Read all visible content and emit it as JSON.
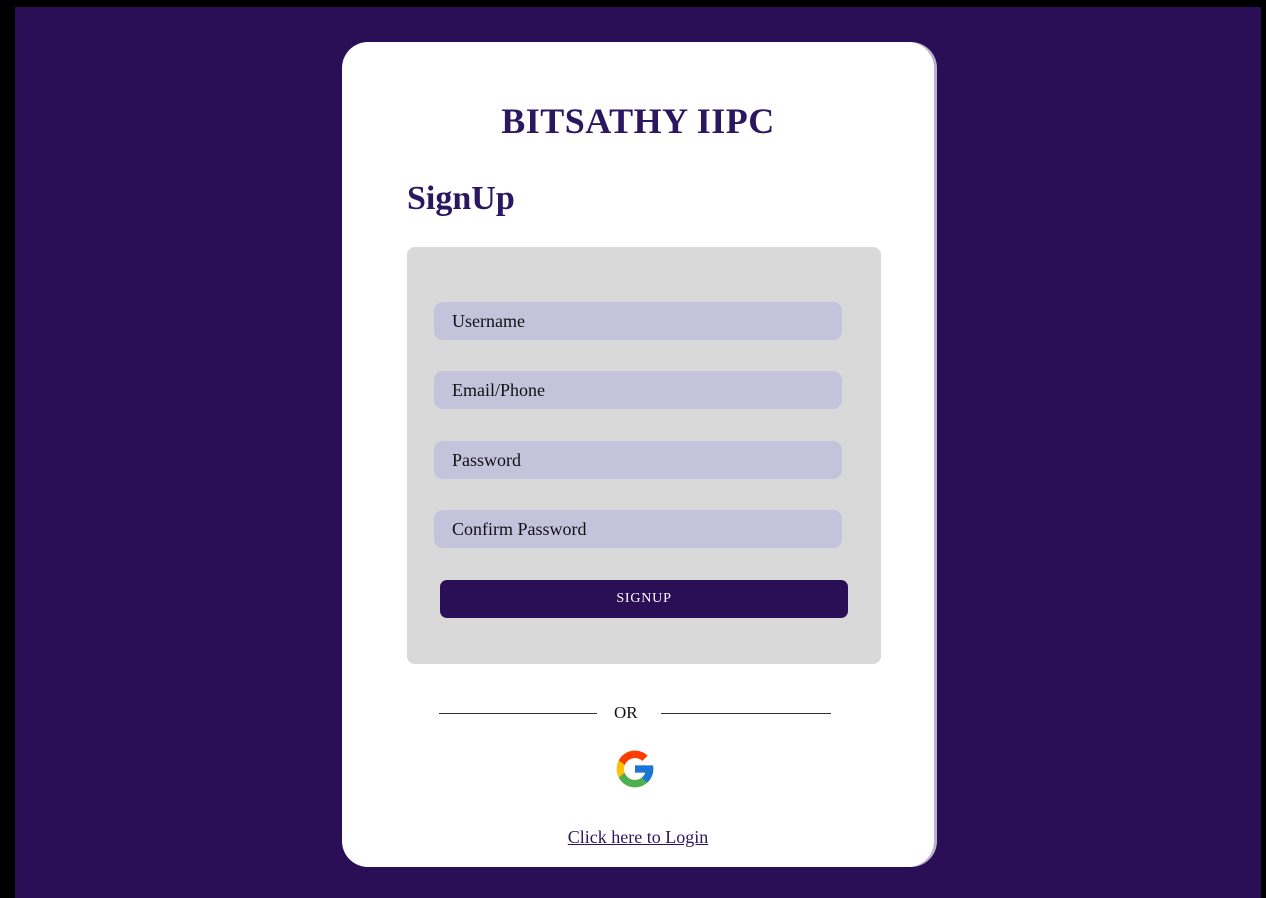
{
  "app": {
    "brand_title": "BITSATHY IIPC",
    "page_heading": "SignUp"
  },
  "form": {
    "fields": [
      {
        "name": "username",
        "placeholder": "Username",
        "value": ""
      },
      {
        "name": "email_phone",
        "placeholder": "Email/Phone",
        "value": ""
      },
      {
        "name": "password",
        "placeholder": "Password",
        "value": ""
      },
      {
        "name": "confirm_password",
        "placeholder": "Confirm Password",
        "value": ""
      }
    ],
    "submit_label": "SIGNUP"
  },
  "alt_auth": {
    "divider_label": "OR",
    "provider_icon": "google-icon"
  },
  "footer": {
    "login_link": "Click here to Login"
  },
  "colors": {
    "background": "#2a0f57",
    "card": "#ffffff",
    "form_panel": "#d9d9d9",
    "input_fill": "#c4c3dc",
    "accent": "#2a1760",
    "button": "#2a0f57"
  }
}
